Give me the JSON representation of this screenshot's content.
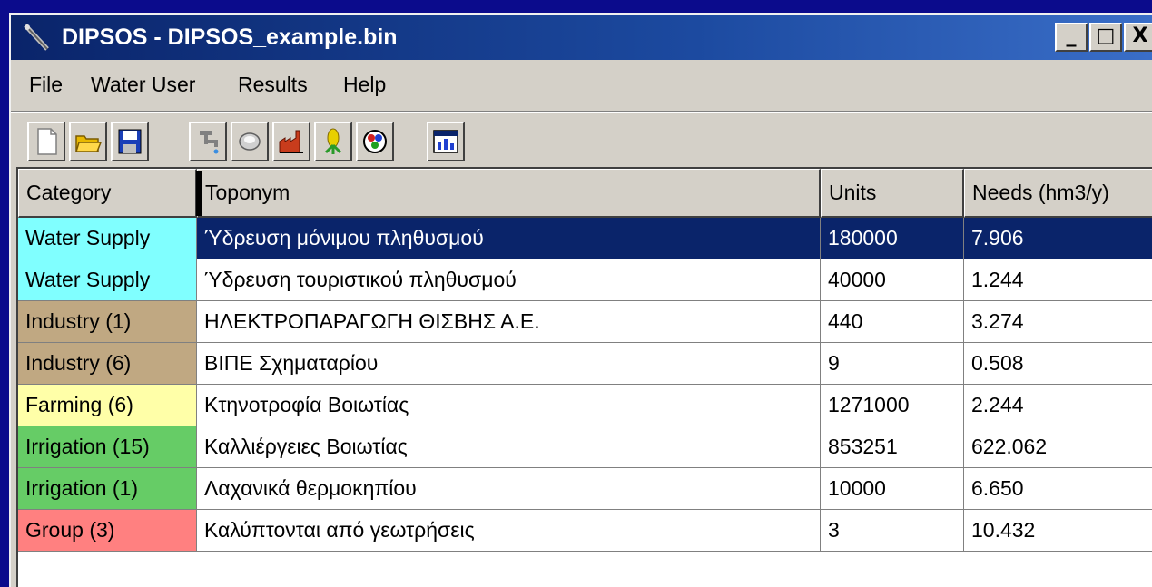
{
  "window": {
    "title": "DIPSOS - DIPSOS_example.bin",
    "controls": [
      "minimize",
      "maximize",
      "close"
    ]
  },
  "menu": [
    "File",
    "Water User",
    "Results",
    "Help"
  ],
  "toolbar": {
    "buttons": [
      {
        "name": "new-icon"
      },
      {
        "name": "open-folder-icon"
      },
      {
        "name": "save-icon"
      },
      {
        "name": "water-tap-icon"
      },
      {
        "name": "tourism-icon"
      },
      {
        "name": "industry-icon"
      },
      {
        "name": "irrigation-icon"
      },
      {
        "name": "group-icon"
      },
      {
        "name": "results-window-icon"
      }
    ]
  },
  "table": {
    "headers": [
      "Category",
      "Toponym",
      "Units",
      "Needs (hm3/y)"
    ],
    "rows": [
      {
        "category": "Water Supply",
        "toponym": "Ύδρευση μόνιμου πληθυσμού",
        "units": "180000",
        "needs": "7.906",
        "color": "#80ffff",
        "selected": true
      },
      {
        "category": "Water Supply",
        "toponym": "Ύδρευση τουριστικού πληθυσμού",
        "units": "40000",
        "needs": "1.244",
        "color": "#80ffff",
        "selected": false
      },
      {
        "category": "Industry (1)",
        "toponym": "ΗΛΕΚΤΡΟΠΑΡΑΓΩΓΗ ΘΙΣΒΗΣ Α.Ε.",
        "units": "440",
        "needs": "3.274",
        "color": "#c0a882",
        "selected": false
      },
      {
        "category": "Industry (6)",
        "toponym": "ΒΙΠΕ Σχηματαρίου",
        "units": "9",
        "needs": "0.508",
        "color": "#c0a882",
        "selected": false
      },
      {
        "category": "Farming (6)",
        "toponym": "Κτηνοτροφία Βοιωτίας",
        "units": "1271000",
        "needs": "2.244",
        "color": "#ffffa8",
        "selected": false
      },
      {
        "category": "Irrigation (15)",
        "toponym": "Καλλιέργειες Βοιωτίας",
        "units": "853251",
        "needs": "622.062",
        "color": "#66cc66",
        "selected": false
      },
      {
        "category": "Irrigation (1)",
        "toponym": "Λαχανικά θερμοκηπίου",
        "units": "10000",
        "needs": "6.650",
        "color": "#66cc66",
        "selected": false
      },
      {
        "category": "Group (3)",
        "toponym": "Καλύπτονται από γεωτρήσεις",
        "units": "3",
        "needs": "10.432",
        "color": "#ff8080",
        "selected": false
      }
    ]
  }
}
